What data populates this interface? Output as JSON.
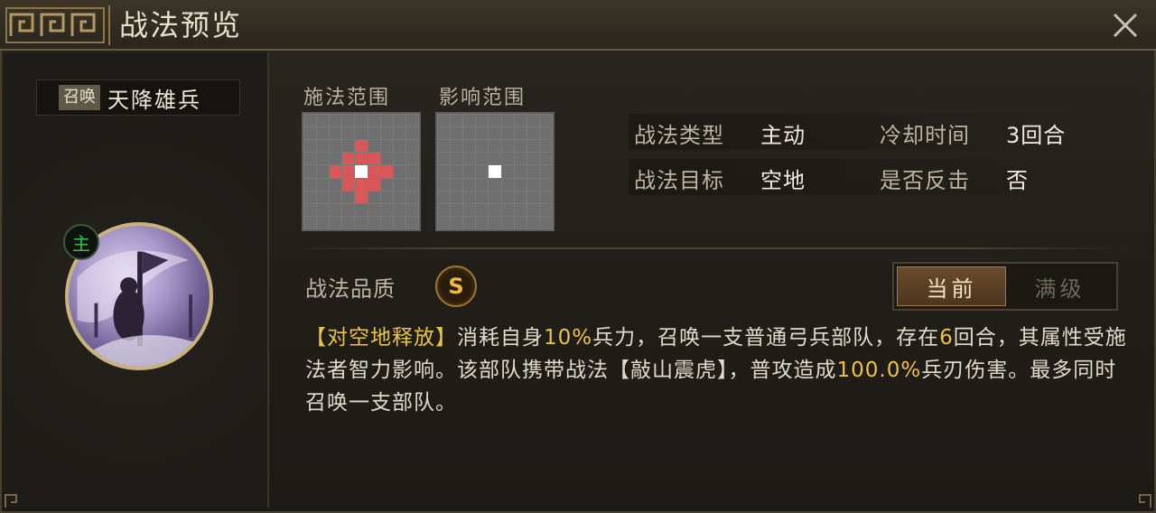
{
  "header": {
    "title": "战法预览"
  },
  "skill": {
    "tag": "召唤",
    "name": "天降雄兵",
    "badge": "主"
  },
  "ranges": {
    "cast_label": "施法范围",
    "effect_label": "影响范围"
  },
  "info": {
    "type_label": "战法类型",
    "type_value": "主动",
    "cooldown_label": "冷却时间",
    "cooldown_value": "3回合",
    "target_label": "战法目标",
    "target_value": "空地",
    "counter_label": "是否反击",
    "counter_value": "否"
  },
  "quality": {
    "label": "战法品质",
    "grade": "S"
  },
  "toggle": {
    "current": "当前",
    "max": "满级"
  },
  "description": {
    "p1": "【对空地释放】",
    "p2": "消耗自身",
    "p3": "10%",
    "p4": "兵力，召唤一支普通弓兵部队，存在",
    "p5": "6",
    "p6": "回合，其属性受施法者智力影响。该部队携带战法【敲山震虎】，普攻造成",
    "p7": "100.0%",
    "p8": "兵刃伤害。最多同时召唤一支部队。"
  },
  "colors": {
    "highlight": "#e9c34e",
    "accent": "#c9b27c",
    "red_cell": "#d8585a",
    "main_badge": "#35c253"
  },
  "icons": {
    "close": "close-icon",
    "quality": "quality-s-icon"
  }
}
